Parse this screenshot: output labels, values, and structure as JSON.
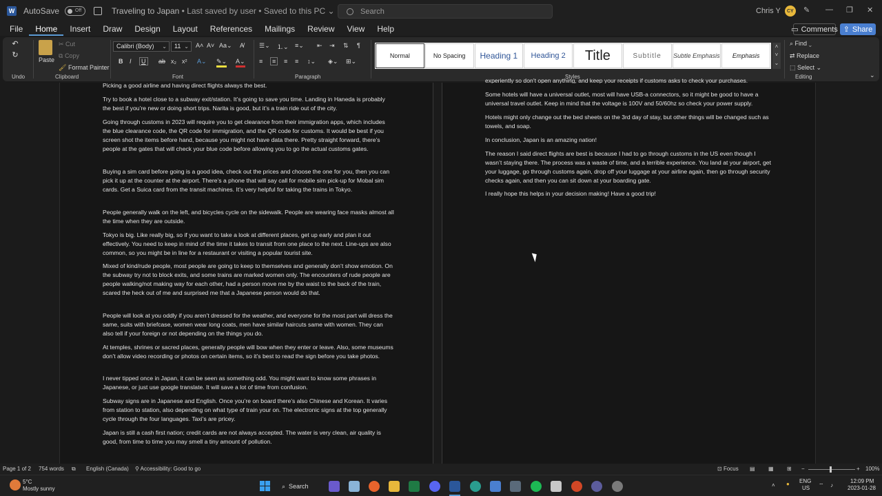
{
  "titlebar": {
    "autosave_label": "AutoSave",
    "autosave_state": "Off",
    "document_title": "Traveling to Japan",
    "save_status": "Last saved by user",
    "location": "Saved to this PC",
    "search_placeholder": "Search",
    "user_name": "Chris Y",
    "user_initials": "CY"
  },
  "menu": {
    "items": [
      "File",
      "Home",
      "Insert",
      "Draw",
      "Design",
      "Layout",
      "References",
      "Mailings",
      "Review",
      "View",
      "Help"
    ],
    "active": "Home",
    "comments_label": "Comments",
    "share_label": "Share"
  },
  "ribbon": {
    "undo_label": "Undo",
    "clipboard": {
      "paste": "Paste",
      "cut": "Cut",
      "copy": "Copy",
      "format_painter": "Format Painter",
      "label": "Clipboard"
    },
    "font": {
      "family": "Calibri (Body)",
      "size": "11",
      "label": "Font"
    },
    "paragraph_label": "Paragraph",
    "styles": {
      "label": "Styles",
      "items": [
        "Normal",
        "No Spacing",
        "Heading 1",
        "Heading 2",
        "Title",
        "Subtitle",
        "Subtle Emphasis",
        "Emphasis"
      ],
      "selected": "Normal"
    },
    "editing": {
      "find": "Find",
      "replace": "Replace",
      "select": "Select",
      "label": "Editing"
    }
  },
  "document": {
    "left_page": [
      "Picking a good airline and having direct flights always the best.",
      "Try to book a hotel close to a subway exit/station. It’s going to save you time. Landing in Haneda is probably the best if you’re new or doing short trips. Narita is good, but it’s a train ride out of the city.",
      "Going through customs in 2023 will require you to get clearance from their immigration apps, which includes the blue clearance code, the QR code for immigration, and the QR code for customs. It would be best if you screen shot the items before hand, because you might not have data there. Pretty straight forward, there’s people at the gates that will check your blue code before allowing you to go the actual customs gates.",
      "Buying a sim card before going is a good idea, check out the prices and choose the one for you, then you can pick it up at the counter at the airport. There’s a phone that will say call for mobile sim pick-up for Mobal sim cards. Get a Suica card from the transit machines. It’s very helpful for taking the trains in Tokyo.",
      "People generally walk on the left, and bicycles cycle on the sidewalk. People are wearing face masks almost all the time when they are outside.",
      "Tokyo is big. Like really big, so if you want to take a look at different places, get up early and plan it out effectively. You need to keep in mind of the time it takes to transit from one place to the next. Line-ups are also common, so you might be in line for a restaurant or visiting a popular tourist site.",
      "Mixed of kind/rude people, most people are going to keep to themselves and generally don’t show emotion. On the subway try not to block exits, and some trains are marked women only.  The encounters of rude people are people walking/not making way for each other, had a person move me by the waist to the back of the train, scared the heck out of me and surprised me that a Japanese person would do that.",
      "People will look at you oddly if you aren’t dressed for the weather, and everyone for the most part will dress the same, suits with briefcase, women wear long coats, men have similar haircuts same with women. They can also tell if your foreign or not depending on the things you do.",
      "At temples, shrines or sacred places, generally people will bow when they enter or leave. Also, some museums don’t allow video recording or photos on certain items, so it’s best to read the sign before you take photos.",
      "I never tipped once in Japan, it can be seen as something odd. You might want to know some phrases in Japanese, or just use google translate. It will save a lot of time from confusion.",
      "Subway signs are in Japanese and English. Once you’re on board there’s also Chinese and Korean. It varies from station to station, also depending on what type of train your on. The electronic signs at the top generally cycle through the four languages. Taxi’s are pricey.",
      "Japan is still a cash first nation; credit cards are not always accepted. The water is very clean, air quality is good, from time to time you may smell a tiny amount of pollution."
    ],
    "right_page": [
      "experiently so don’t open anything, and keep your receipts if customs asks to check your purchases.",
      "Some hotels will have a universal outlet, most will have USB-a connectors, so it might be good to have a universal travel outlet. Keep in mind that the voltage is 100V and 50/60hz so check your power supply.",
      "Hotels might only change out the bed sheets on the 3rd day of stay, but other things will be changed such as towels, and soap.",
      "In conclusion, Japan is an amazing nation!",
      "The reason I said direct flights are best is because I had to go through customs in the US even though I wasn’t staying there. The process was a waste of time, and a terrible experience. You land at your airport, get your luggage, go through customs again, drop off your luggage at your airline again, then go through security checks again, and then you can sit down at your boarding gate.",
      "I really hope this helps in your decision making! Have a good trip!"
    ]
  },
  "statusbar": {
    "page": "Page 1 of 2",
    "words": "754 words",
    "language": "English (Canada)",
    "accessibility": "Accessibility: Good to go",
    "focus": "Focus",
    "zoom": "100%"
  },
  "taskbar": {
    "weather_temp": "5°C",
    "weather_desc": "Mostly sunny",
    "search_label": "Search",
    "lang_top": "ENG",
    "lang_bottom": "US",
    "time": "12:09 PM",
    "date": "2023-01-28"
  }
}
